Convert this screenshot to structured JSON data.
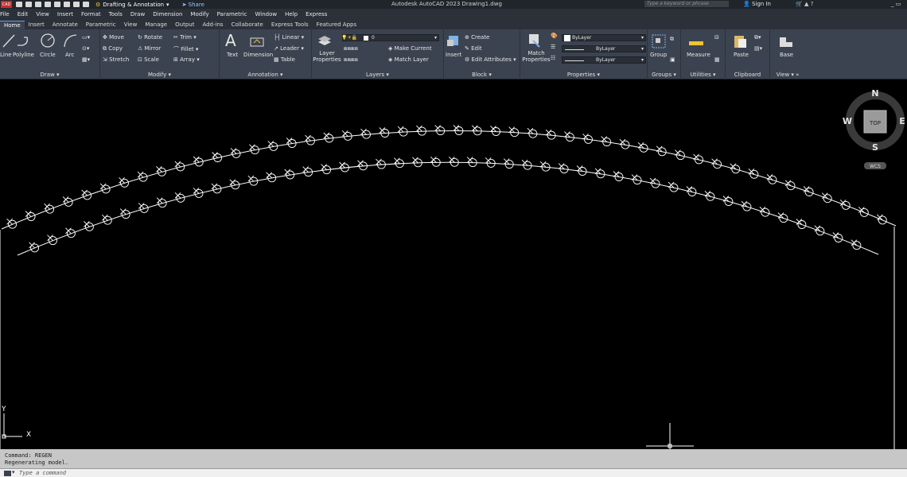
{
  "titlebar": {
    "logo": "CAD",
    "workspace": "Drafting & Annotation",
    "share": "Share",
    "title": "Autodesk AutoCAD 2023   Drawing1.dwg",
    "search_placeholder": "Type a keyword or phrase",
    "sign_in": "Sign In"
  },
  "menu": [
    "File",
    "Edit",
    "View",
    "Insert",
    "Format",
    "Tools",
    "Draw",
    "Dimension",
    "Modify",
    "Parametric",
    "Window",
    "Help",
    "Express"
  ],
  "ribbon_tabs": [
    "Home",
    "Insert",
    "Annotate",
    "Parametric",
    "View",
    "Manage",
    "Output",
    "Add-ins",
    "Collaborate",
    "Express Tools",
    "Featured Apps"
  ],
  "ribbon": {
    "draw": {
      "title": "Draw",
      "line": "Line",
      "polyline": "Polyline",
      "circle": "Circle",
      "arc": "Arc"
    },
    "modify": {
      "title": "Modify",
      "move": "Move",
      "rotate": "Rotate",
      "trim": "Trim",
      "copy": "Copy",
      "mirror": "Mirror",
      "fillet": "Fillet",
      "stretch": "Stretch",
      "scale": "Scale",
      "array": "Array"
    },
    "annotation": {
      "title": "Annotation",
      "text": "Text",
      "dimension": "Dimension",
      "linear": "Linear",
      "leader": "Leader",
      "table": "Table"
    },
    "layers": {
      "title": "Layers",
      "layer_properties": "Layer Properties",
      "current_layer": "0",
      "make_current": "Make Current",
      "match_layer": "Match Layer"
    },
    "block": {
      "title": "Block",
      "insert": "Insert",
      "create": "Create",
      "edit": "Edit",
      "edit_attributes": "Edit Attributes"
    },
    "properties": {
      "title": "Properties",
      "match": "Match Properties",
      "color": "ByLayer",
      "linetype": "ByLayer",
      "lineweight": "ByLayer"
    },
    "groups": {
      "title": "Groups",
      "group": "Group"
    },
    "utilities": {
      "title": "Utilities",
      "measure": "Measure"
    },
    "clipboard": {
      "title": "Clipboard",
      "paste": "Paste"
    },
    "view": {
      "title": "View",
      "base": "Base"
    }
  },
  "viewcube": {
    "n": "N",
    "s": "S",
    "e": "E",
    "w": "W",
    "top": "TOP",
    "wcs": "WCS"
  },
  "ucs": {
    "x": "X",
    "y": "Y"
  },
  "command": {
    "line1": "Command: REGEN",
    "line2": "Regenerating model.",
    "placeholder": "Type a command"
  },
  "colors": {
    "canvas": "#000000",
    "ribbon": "#3b4350",
    "accent": "#5aa0e8"
  }
}
